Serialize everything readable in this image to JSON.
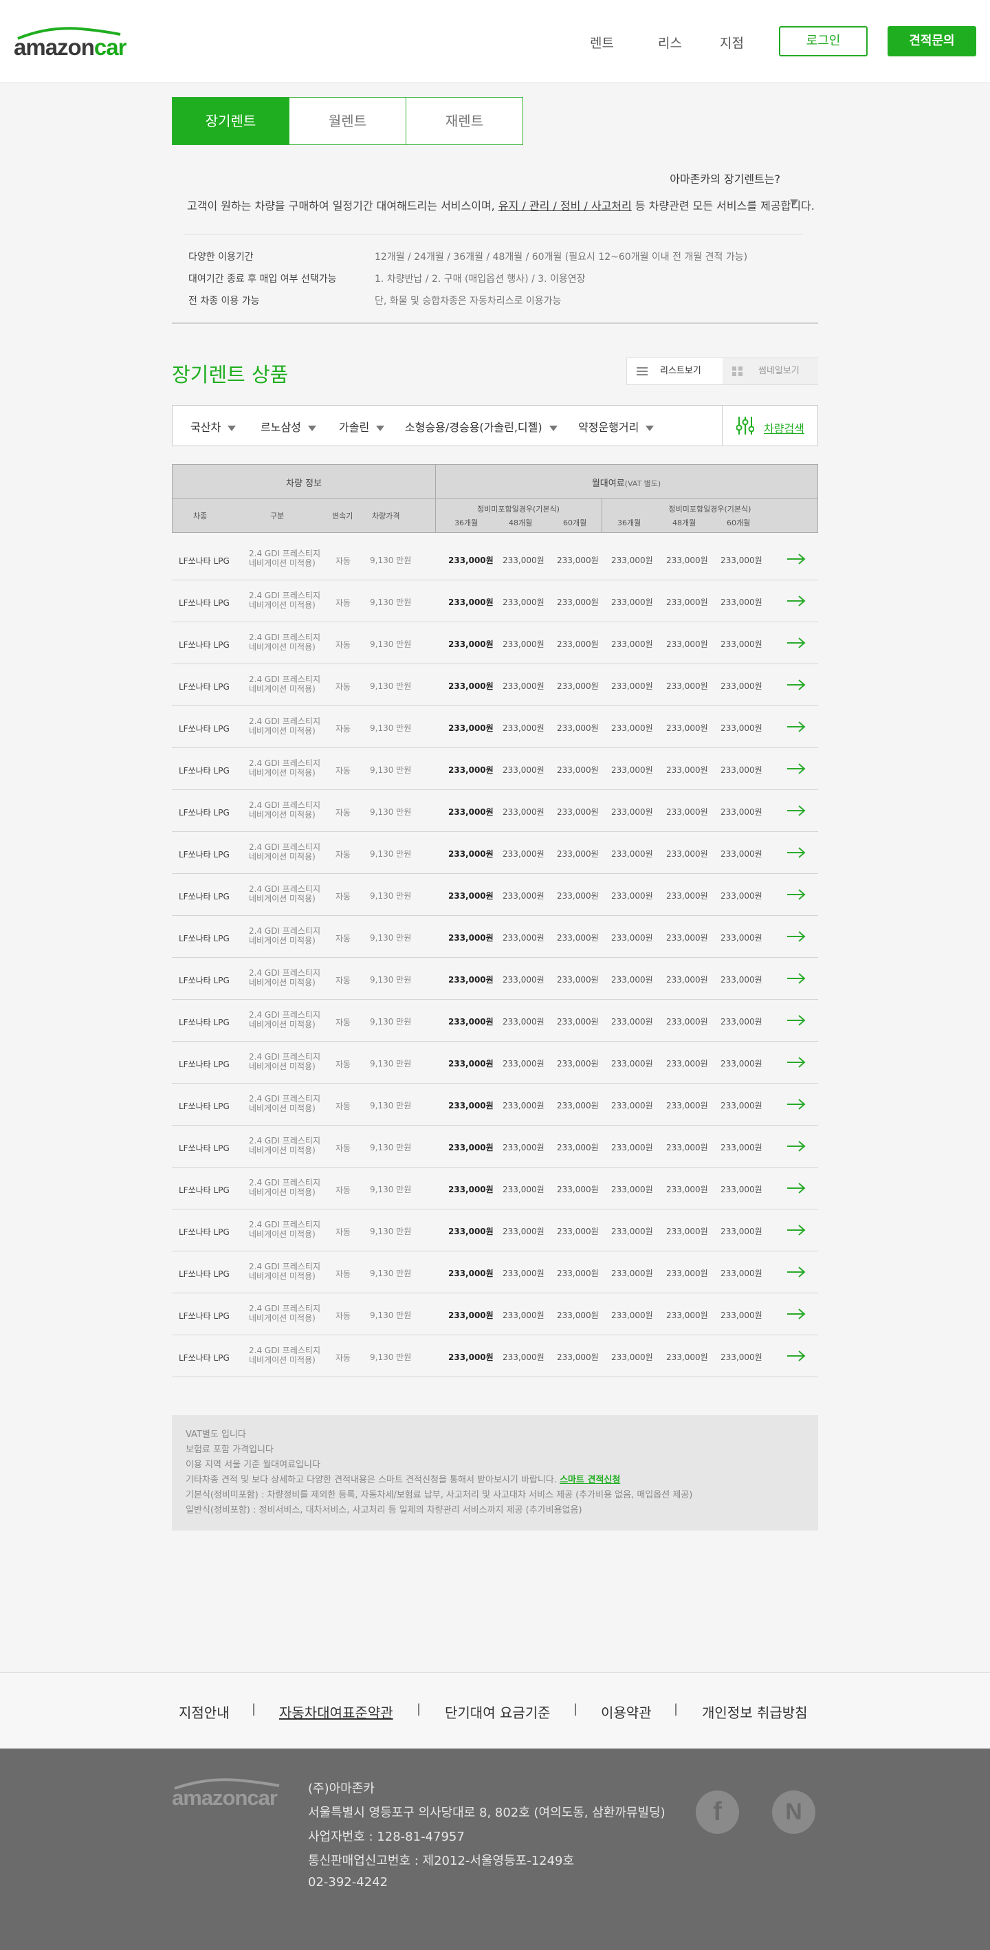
{
  "header": {
    "logo": {
      "part1": "amazon",
      "part2": "car"
    },
    "nav": [
      "렌트",
      "리스",
      "지점"
    ],
    "login_label": "로그인",
    "quote_label": "견적문의"
  },
  "tabs": [
    "장기렌트",
    "월렌트",
    "재렌트"
  ],
  "intro": {
    "title": "아마존카의 장기렌트는?",
    "desc_pre": "고객이 원하는 차량을 구매하여 일정기간 대여해드리는 서비스이며, ",
    "desc_link": "유지 / 관리 / 정비 / 사고처리",
    "desc_post": " 등 차량관련 모든 서비스를 제공합니다.",
    "features": [
      {
        "label": "다양한 이용기간",
        "value": "12개월 / 24개월 / 36개월 / 48개월 / 60개월 (필요시 12~60개월 이내 전 개월 견적 가능)"
      },
      {
        "label": "대여기간 종료 후 매입 여부 선택가능",
        "value": "1. 차량반납  /  2. 구매 (매입옵션 행사)  /  3. 이용연장"
      },
      {
        "label": "전 차종 이용 가능",
        "value": "단, 화물 및 승합차종은 자동차리스로 이용가능"
      }
    ]
  },
  "products": {
    "title": "장기렌트 상품",
    "list_view": "리스트보기",
    "gallery_view": "썸네일보기"
  },
  "filters": [
    "국산차",
    "르노삼성",
    "가솔린",
    "소형승용/경승용(가솔린,디젤)",
    "약정운행거리"
  ],
  "search_label": "차량검색",
  "table": {
    "group_vehicle": "차량 정보",
    "group_fee": "월대여료",
    "group_fee_note": "(VAT 별도)",
    "cols": [
      "차종",
      "구분",
      "변속기",
      "차량가격"
    ],
    "sub_groups": [
      "정비미포함일경우(기본식)",
      "정비미포함일경우(기본식)"
    ],
    "months": [
      "36개월",
      "48개월",
      "60개월",
      "36개월",
      "48개월",
      "60개월"
    ],
    "rows": [
      {
        "model": "LF쏘나타 LPG",
        "trim1": "2.4 GDI 프레스티지",
        "trim2": "네비게이션 미적용)",
        "trans": "자동",
        "price": "9,130 만원",
        "fees": [
          "233,000원",
          "233,000원",
          "233,000원",
          "233,000원",
          "233,000원",
          "233,000원"
        ]
      },
      {
        "model": "LF쏘나타 LPG",
        "trim1": "2.4 GDI 프레스티지",
        "trim2": "네비게이션 미적용)",
        "trans": "자동",
        "price": "9,130 만원",
        "fees": [
          "233,000원",
          "233,000원",
          "233,000원",
          "233,000원",
          "233,000원",
          "233,000원"
        ]
      },
      {
        "model": "LF쏘나타 LPG",
        "trim1": "2.4 GDI 프레스티지",
        "trim2": "네비게이션 미적용)",
        "trans": "자동",
        "price": "9,130 만원",
        "fees": [
          "233,000원",
          "233,000원",
          "233,000원",
          "233,000원",
          "233,000원",
          "233,000원"
        ]
      },
      {
        "model": "LF쏘나타 LPG",
        "trim1": "2.4 GDI 프레스티지",
        "trim2": "네비게이션 미적용)",
        "trans": "자동",
        "price": "9,130 만원",
        "fees": [
          "233,000원",
          "233,000원",
          "233,000원",
          "233,000원",
          "233,000원",
          "233,000원"
        ]
      },
      {
        "model": "LF쏘나타 LPG",
        "trim1": "2.4 GDI 프레스티지",
        "trim2": "네비게이션 미적용)",
        "trans": "자동",
        "price": "9,130 만원",
        "fees": [
          "233,000원",
          "233,000원",
          "233,000원",
          "233,000원",
          "233,000원",
          "233,000원"
        ]
      },
      {
        "model": "LF쏘나타 LPG",
        "trim1": "2.4 GDI 프레스티지",
        "trim2": "네비게이션 미적용)",
        "trans": "자동",
        "price": "9,130 만원",
        "fees": [
          "233,000원",
          "233,000원",
          "233,000원",
          "233,000원",
          "233,000원",
          "233,000원"
        ]
      },
      {
        "model": "LF쏘나타 LPG",
        "trim1": "2.4 GDI 프레스티지",
        "trim2": "네비게이션 미적용)",
        "trans": "자동",
        "price": "9,130 만원",
        "fees": [
          "233,000원",
          "233,000원",
          "233,000원",
          "233,000원",
          "233,000원",
          "233,000원"
        ]
      },
      {
        "model": "LF쏘나타 LPG",
        "trim1": "2.4 GDI 프레스티지",
        "trim2": "네비게이션 미적용)",
        "trans": "자동",
        "price": "9,130 만원",
        "fees": [
          "233,000원",
          "233,000원",
          "233,000원",
          "233,000원",
          "233,000원",
          "233,000원"
        ]
      },
      {
        "model": "LF쏘나타 LPG",
        "trim1": "2.4 GDI 프레스티지",
        "trim2": "네비게이션 미적용)",
        "trans": "자동",
        "price": "9,130 만원",
        "fees": [
          "233,000원",
          "233,000원",
          "233,000원",
          "233,000원",
          "233,000원",
          "233,000원"
        ]
      },
      {
        "model": "LF쏘나타 LPG",
        "trim1": "2.4 GDI 프레스티지",
        "trim2": "네비게이션 미적용)",
        "trans": "자동",
        "price": "9,130 만원",
        "fees": [
          "233,000원",
          "233,000원",
          "233,000원",
          "233,000원",
          "233,000원",
          "233,000원"
        ]
      },
      {
        "model": "LF쏘나타 LPG",
        "trim1": "2.4 GDI 프레스티지",
        "trim2": "네비게이션 미적용)",
        "trans": "자동",
        "price": "9,130 만원",
        "fees": [
          "233,000원",
          "233,000원",
          "233,000원",
          "233,000원",
          "233,000원",
          "233,000원"
        ]
      },
      {
        "model": "LF쏘나타 LPG",
        "trim1": "2.4 GDI 프레스티지",
        "trim2": "네비게이션 미적용)",
        "trans": "자동",
        "price": "9,130 만원",
        "fees": [
          "233,000원",
          "233,000원",
          "233,000원",
          "233,000원",
          "233,000원",
          "233,000원"
        ]
      },
      {
        "model": "LF쏘나타 LPG",
        "trim1": "2.4 GDI 프레스티지",
        "trim2": "네비게이션 미적용)",
        "trans": "자동",
        "price": "9,130 만원",
        "fees": [
          "233,000원",
          "233,000원",
          "233,000원",
          "233,000원",
          "233,000원",
          "233,000원"
        ]
      },
      {
        "model": "LF쏘나타 LPG",
        "trim1": "2.4 GDI 프레스티지",
        "trim2": "네비게이션 미적용)",
        "trans": "자동",
        "price": "9,130 만원",
        "fees": [
          "233,000원",
          "233,000원",
          "233,000원",
          "233,000원",
          "233,000원",
          "233,000원"
        ]
      },
      {
        "model": "LF쏘나타 LPG",
        "trim1": "2.4 GDI 프레스티지",
        "trim2": "네비게이션 미적용)",
        "trans": "자동",
        "price": "9,130 만원",
        "fees": [
          "233,000원",
          "233,000원",
          "233,000원",
          "233,000원",
          "233,000원",
          "233,000원"
        ]
      },
      {
        "model": "LF쏘나타 LPG",
        "trim1": "2.4 GDI 프레스티지",
        "trim2": "네비게이션 미적용)",
        "trans": "자동",
        "price": "9,130 만원",
        "fees": [
          "233,000원",
          "233,000원",
          "233,000원",
          "233,000원",
          "233,000원",
          "233,000원"
        ]
      },
      {
        "model": "LF쏘나타 LPG",
        "trim1": "2.4 GDI 프레스티지",
        "trim2": "네비게이션 미적용)",
        "trans": "자동",
        "price": "9,130 만원",
        "fees": [
          "233,000원",
          "233,000원",
          "233,000원",
          "233,000원",
          "233,000원",
          "233,000원"
        ]
      },
      {
        "model": "LF쏘나타 LPG",
        "trim1": "2.4 GDI 프레스티지",
        "trim2": "네비게이션 미적용)",
        "trans": "자동",
        "price": "9,130 만원",
        "fees": [
          "233,000원",
          "233,000원",
          "233,000원",
          "233,000원",
          "233,000원",
          "233,000원"
        ]
      },
      {
        "model": "LF쏘나타 LPG",
        "trim1": "2.4 GDI 프레스티지",
        "trim2": "네비게이션 미적용)",
        "trans": "자동",
        "price": "9,130 만원",
        "fees": [
          "233,000원",
          "233,000원",
          "233,000원",
          "233,000원",
          "233,000원",
          "233,000원"
        ]
      },
      {
        "model": "LF쏘나타 LPG",
        "trim1": "2.4 GDI 프레스티지",
        "trim2": "네비게이션 미적용)",
        "trans": "자동",
        "price": "9,130 만원",
        "fees": [
          "233,000원",
          "233,000원",
          "233,000원",
          "233,000원",
          "233,000원",
          "233,000원"
        ]
      }
    ]
  },
  "notes": {
    "lines": [
      "VAT별도 입니다",
      "보험료 포함 가격입니다",
      "이용 지역 서울 기준 월대여료입니다"
    ],
    "line4_pre": "기타차종 견적 및 보다 상세하고 다양한 견적내용은 스마트 견적신청을 통해서 받아보시기 바랍니다. ",
    "line4_link": "스마트 견적신청",
    "line5": "기본식(정비미포함) : 차량정비를 제외한 등록, 자동차세/보험료 납부, 사고처리 및 사고대차 서비스 제공 (추가비용 없음, 매입옵션 제공)",
    "line6": " 일반식(정비포함) : 정비서비스, 대차서비스, 사고처리 등 일체의 차량관리 서비스까지 제공 (추가비용없음)"
  },
  "footer_links": [
    "지점안내",
    "자동차대여표준약관",
    "단기대여 요금기준",
    "이용약관",
    "개인정보 취급방침"
  ],
  "footer_sep": "|",
  "footer": {
    "logo": "amazoncar",
    "company": "(주)아마존카",
    "address": "서울특별시 영등포구 의사당대로 8, 802호 (여의도동, 삼환까뮤빌딩)",
    "biz_no": "사업자번호 : 128-81-47957",
    "ecommerce_no": "통신판매업신고번호 : 제2012-서울영등포-1249호",
    "phone": "02-392-4242",
    "social": [
      "f",
      "N"
    ]
  },
  "colors": {
    "accent": "#1fae1f",
    "footer_bg": "#6b6b6b"
  }
}
